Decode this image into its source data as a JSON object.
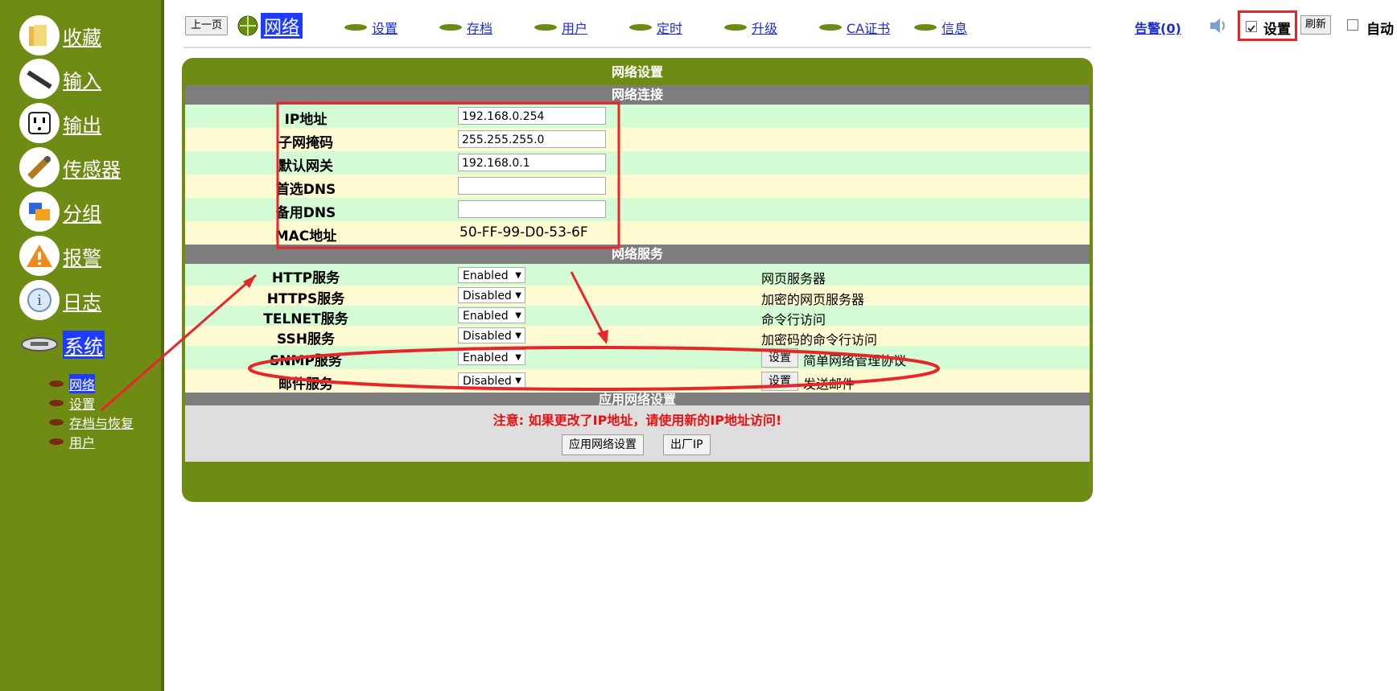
{
  "sidebar": {
    "items": [
      {
        "label": "收藏",
        "icon": "folder-icon"
      },
      {
        "label": "输入",
        "icon": "cable-icon"
      },
      {
        "label": "输出",
        "icon": "power-outlet-icon"
      },
      {
        "label": "传感器",
        "icon": "sensor-icon"
      },
      {
        "label": "分组",
        "icon": "group-icon"
      },
      {
        "label": "报警",
        "icon": "warning-icon"
      },
      {
        "label": "日志",
        "icon": "info-icon"
      },
      {
        "label": "系统",
        "icon": "device-icon"
      }
    ],
    "sub_items": [
      "网络",
      "设置",
      "存档与恢复",
      "用户"
    ]
  },
  "topnav": {
    "prev": "上一页",
    "current": "网络",
    "links": [
      "设置",
      "存档",
      "用户",
      "定时",
      "升级",
      "CA证书",
      "信息"
    ],
    "alarm": "告警(0)",
    "settings_label": "设置",
    "refresh": "刷新",
    "auto": "自动"
  },
  "panel": {
    "title": "网络设置",
    "sec_connection": "网络连接",
    "connection_rows": [
      {
        "label": "IP地址",
        "value": "192.168.0.254"
      },
      {
        "label": "子网掩码",
        "value": "255.255.255.0"
      },
      {
        "label": "默认网关",
        "value": "192.168.0.1"
      },
      {
        "label": "首选DNS",
        "value": ""
      },
      {
        "label": "备用DNS",
        "value": ""
      }
    ],
    "mac_label": "MAC地址",
    "mac_value": "50-FF-99-D0-53-6F",
    "sec_services": "网络服务",
    "services": [
      {
        "label": "HTTP服务",
        "state": "Enabled",
        "desc": "网页服务器",
        "button": ""
      },
      {
        "label": "HTTPS服务",
        "state": "Disabled",
        "desc": "加密的网页服务器",
        "button": ""
      },
      {
        "label": "TELNET服务",
        "state": "Enabled",
        "desc": "命令行访问",
        "button": ""
      },
      {
        "label": "SSH服务",
        "state": "Disabled",
        "desc": "加密码的命令行访问",
        "button": ""
      },
      {
        "label": "SNMP服务",
        "state": "Enabled",
        "desc": "简单网络管理协议",
        "button": "设置"
      },
      {
        "label": "邮件服务",
        "state": "Disabled",
        "desc": "发送邮件",
        "button": "设置"
      }
    ],
    "sec_apply": "应用网络设置",
    "note": "注意: 如果更改了IP地址，请使用新的IP地址访问!",
    "apply_btn": "应用网络设置",
    "factory_btn": "出厂IP"
  },
  "colors": {
    "sidebar": "#6e8b13",
    "link": "#1b2bd6",
    "annotation": "#e8262a"
  }
}
